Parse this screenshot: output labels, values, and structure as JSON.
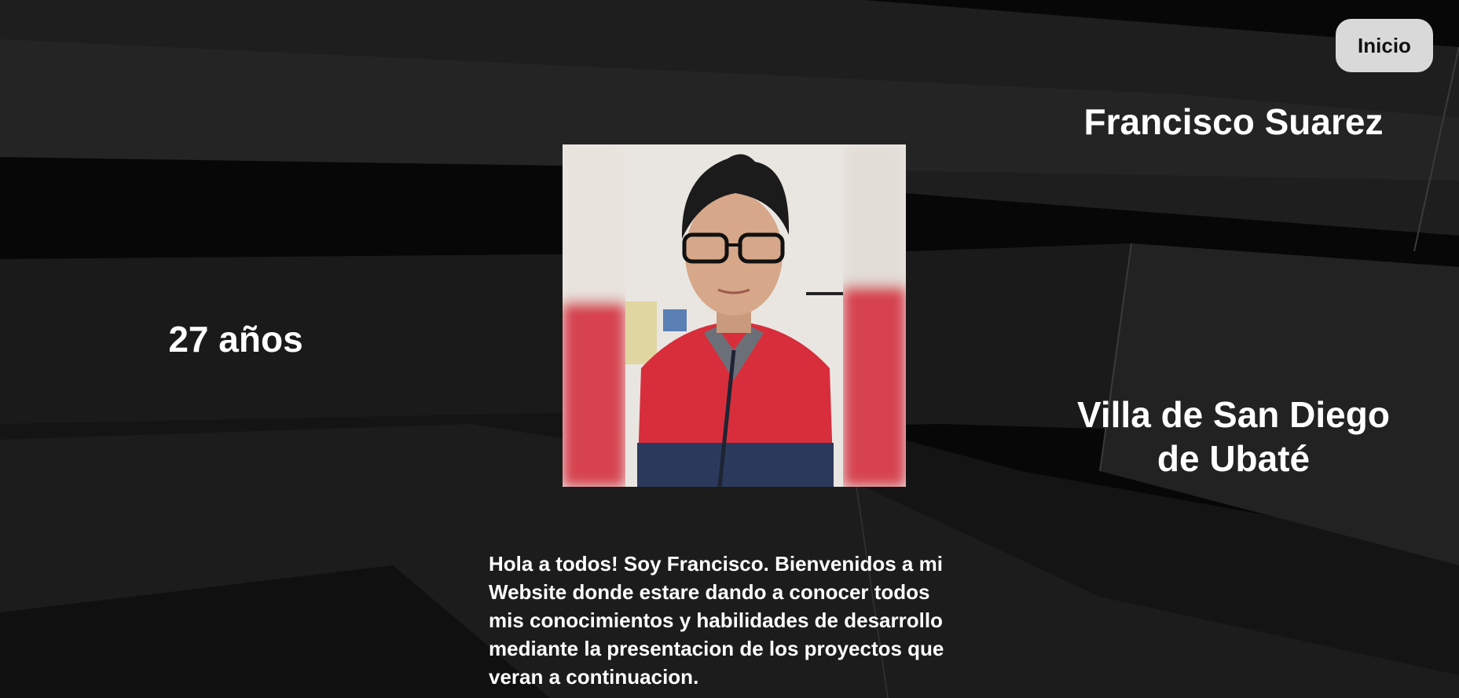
{
  "nav": {
    "home_label": "Inicio"
  },
  "profile": {
    "name": "Francisco Suarez",
    "age": "27 años",
    "location_line1": "Villa de San Diego",
    "location_line2": "de Ubaté",
    "intro": "Hola a todos! Soy Francisco. Bienvenidos a mi Website donde estare dando a conocer todos mis conocimientos y habilidades de desarrollo mediante la presentacion de los proyectos que veran a continuacion."
  },
  "colors": {
    "background": "#0b0b0b",
    "button_bg": "#d9d9d9",
    "text": "#ffffff",
    "jacket_red": "#d82e3c",
    "jacket_navy": "#2b3a5c"
  }
}
